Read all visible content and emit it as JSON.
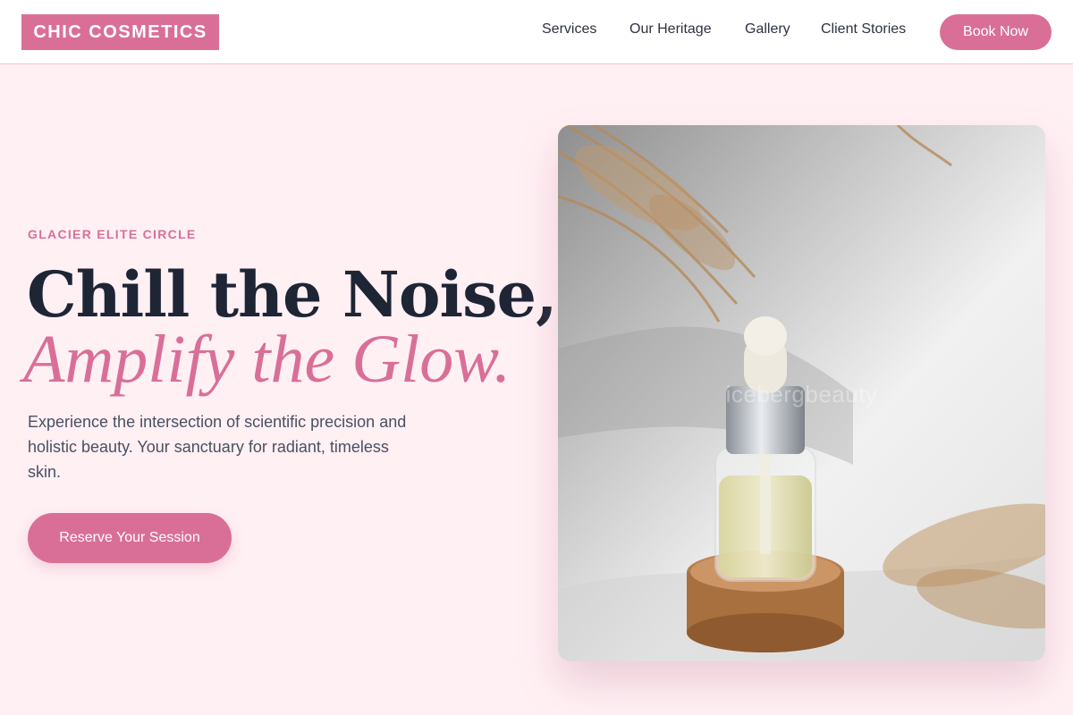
{
  "header": {
    "logo": "CHIC COSMETICS",
    "nav": [
      "Services",
      "Our Heritage",
      "Gallery",
      "Client Stories"
    ],
    "cta": "Book Now"
  },
  "hero": {
    "eyebrow": "GLACIER ELITE CIRCLE",
    "headline_line1": "Chill the Noise,",
    "headline_line2": "Amplify the Glow.",
    "lede": "Experience the intersection of scientific precision and holistic beauty. Your sanctuary for radiant, timeless skin.",
    "cta": "Reserve Your Session",
    "image": {
      "subject": "serum-dropper-bottle-on-cork",
      "watermark": "icebergbeauty"
    }
  },
  "colors": {
    "accent": "#d96f97",
    "background": "#fff0f4",
    "heading": "#1e2535",
    "body_text": "#4a5060"
  }
}
